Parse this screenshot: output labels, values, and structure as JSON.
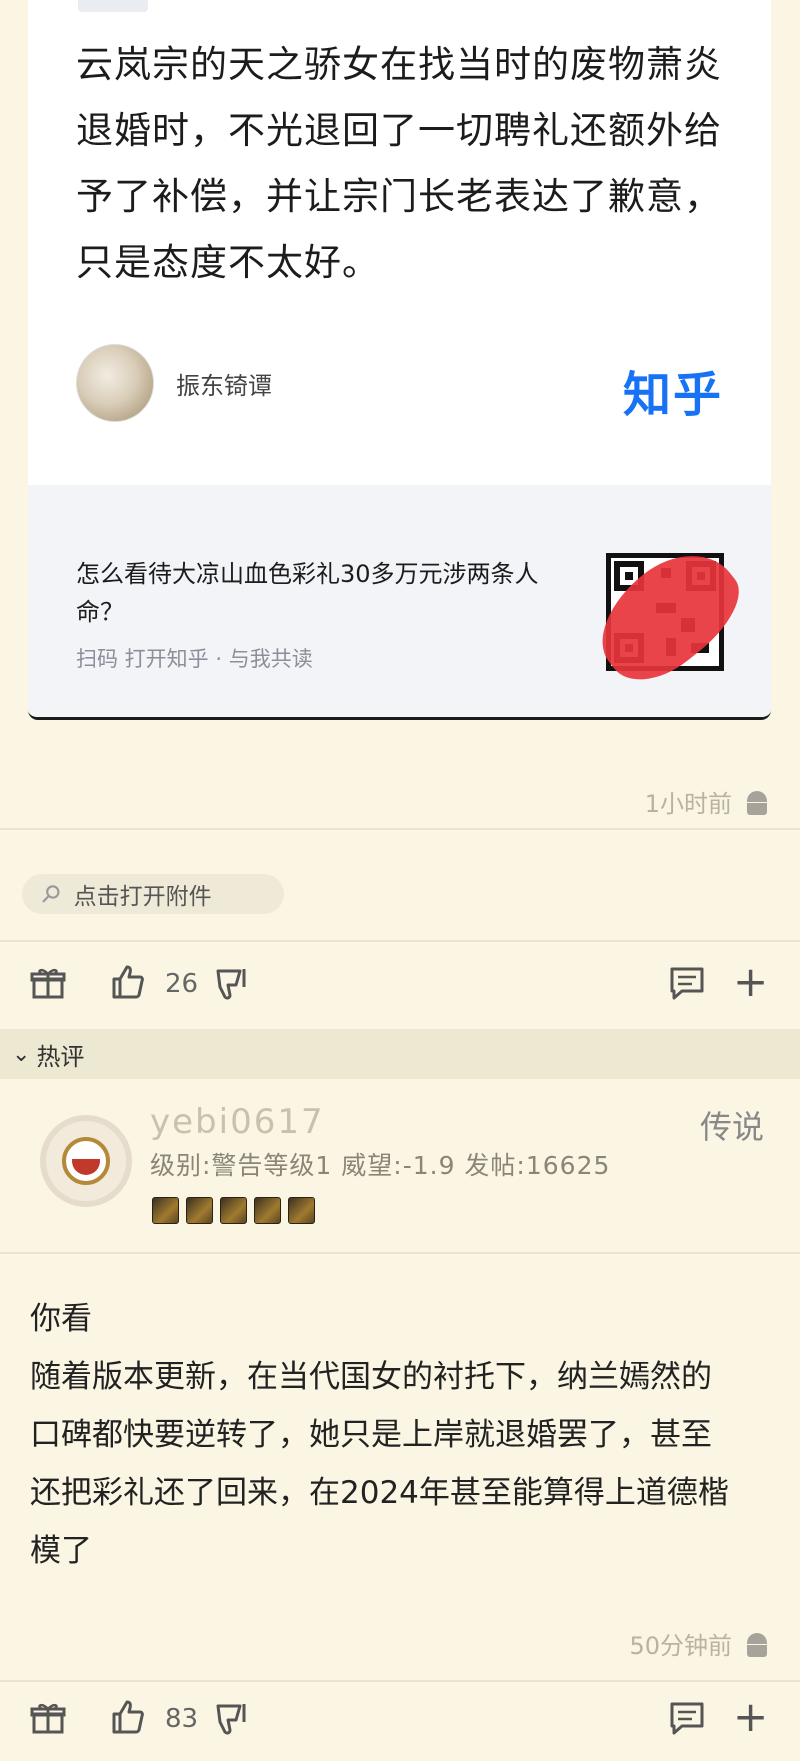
{
  "share_card": {
    "text": "云岚宗的天之骄女在找当时的废物萧炎退婚时，不光退回了一切聘礼还额外给予了补偿，并让宗门长老表达了歉意，只是态度不太好。",
    "author_name": "振东锜谭",
    "brand": "知乎",
    "question": "怎么看待大凉山血色彩礼30多万元涉两条人命？",
    "scan_hint": "扫码 打开知乎 · 与我共读"
  },
  "post": {
    "time": "1小时前",
    "attachment_label": "点击打开附件",
    "like_count": "26"
  },
  "hot_section": {
    "label": "热评"
  },
  "comment": {
    "username": "yebi0617",
    "rank": "传说",
    "stats": "级别:警告等级1 威望:-1.9 发帖:16625",
    "body_lines": [
      "你看",
      "随着版本更新，在当代国女的衬托下，纳兰嫣然的",
      "口碑都快要逆转了，她只是上岸就退婚罢了，甚至",
      "还把彩礼还了回来，在2024年甚至能算得上道德楷",
      "模了"
    ],
    "time": "50分钟前",
    "like_count": "83"
  },
  "colors": {
    "background": "#fbf6e4",
    "brand_blue": "#1772f6",
    "redaction_red": "#e8343c"
  }
}
